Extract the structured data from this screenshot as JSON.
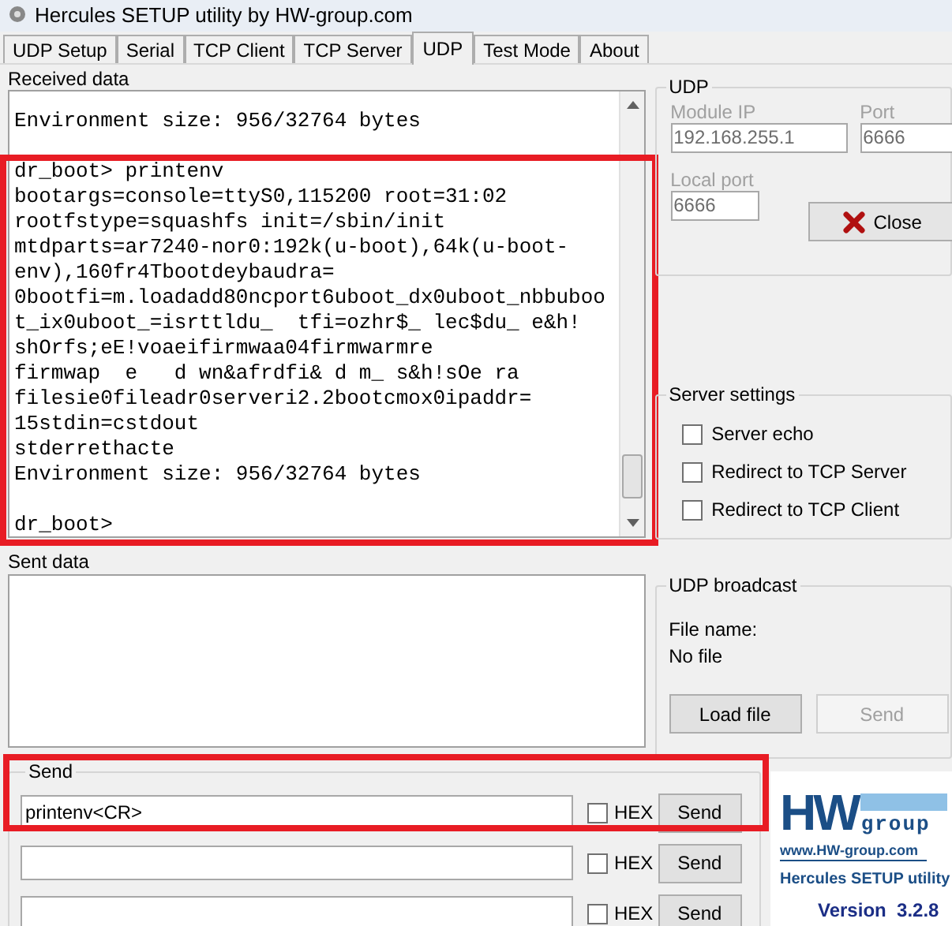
{
  "window": {
    "title": "Hercules SETUP utility by HW-group.com"
  },
  "tabs": [
    {
      "label": "UDP Setup",
      "selected": false
    },
    {
      "label": "Serial",
      "selected": false
    },
    {
      "label": "TCP Client",
      "selected": false
    },
    {
      "label": "TCP Server",
      "selected": false
    },
    {
      "label": "UDP",
      "selected": true
    },
    {
      "label": "Test Mode",
      "selected": false
    },
    {
      "label": "About",
      "selected": false
    }
  ],
  "received": {
    "label": "Received data",
    "highlighted": true,
    "text": "Environment size: 956/32764 bytes\n\ndr_boot> printenv\nbootargs=console=ttyS0,115200 root=31:02\nrootfstype=squashfs init=/sbin/init\nmtdparts=ar7240-nor0:192k(u-boot),64k(u-boot-\nenv),160fr4Tbootdeybaudra=\n0bootfi=m.loadadd80ncport6uboot_dx0uboot_nbbuboo\nt_ix0uboot_=isrttldu_  tfi=ozhr$_ lec$du_ e&h!\nshOrfs;eE!voaeifirmwaa04firmwarmre\nfirmwap  e   d wn&afrdfi& d m_ s&h!sOe ra\nfilesie0fileadr0serveri2.2bootcmox0ipaddr=\n15stdin=cstdout\nstderrethacte\nEnvironment size: 956/32764 bytes\n\ndr_boot>"
  },
  "udp": {
    "title": "UDP",
    "module_ip": {
      "label": "Module IP",
      "value": "192.168.255.1",
      "disabled": true
    },
    "port": {
      "label": "Port",
      "value": "6666",
      "disabled": true
    },
    "local_port": {
      "label": "Local port",
      "value": "6666",
      "disabled": true
    },
    "close_button": "Close"
  },
  "server_settings": {
    "title": "Server settings",
    "options": [
      {
        "label": "Server echo",
        "checked": false
      },
      {
        "label": "Redirect to TCP Server",
        "checked": false
      },
      {
        "label": "Redirect to TCP Client",
        "checked": false
      }
    ]
  },
  "sent": {
    "label": "Sent data"
  },
  "broadcast": {
    "title": "UDP broadcast",
    "file_name_label": "File name:",
    "file_name": "No file",
    "load_button": "Load file",
    "send_button": {
      "label": "Send",
      "disabled": true
    }
  },
  "send": {
    "title": "Send",
    "highlighted": true,
    "rows": [
      {
        "value": "printenv<CR>",
        "hex_label": "HEX",
        "hex": false,
        "button": "Send"
      },
      {
        "hex_label": "HEX",
        "hex": false,
        "button": "Send"
      },
      {
        "hex_label": "HEX",
        "hex": false,
        "button": "Send"
      }
    ]
  },
  "logo": {
    "brand": "HW",
    "brand_suffix": "group",
    "url": "www.HW-group.com",
    "product": "Hercules SETUP utility",
    "version": "Version  3.2.8"
  }
}
